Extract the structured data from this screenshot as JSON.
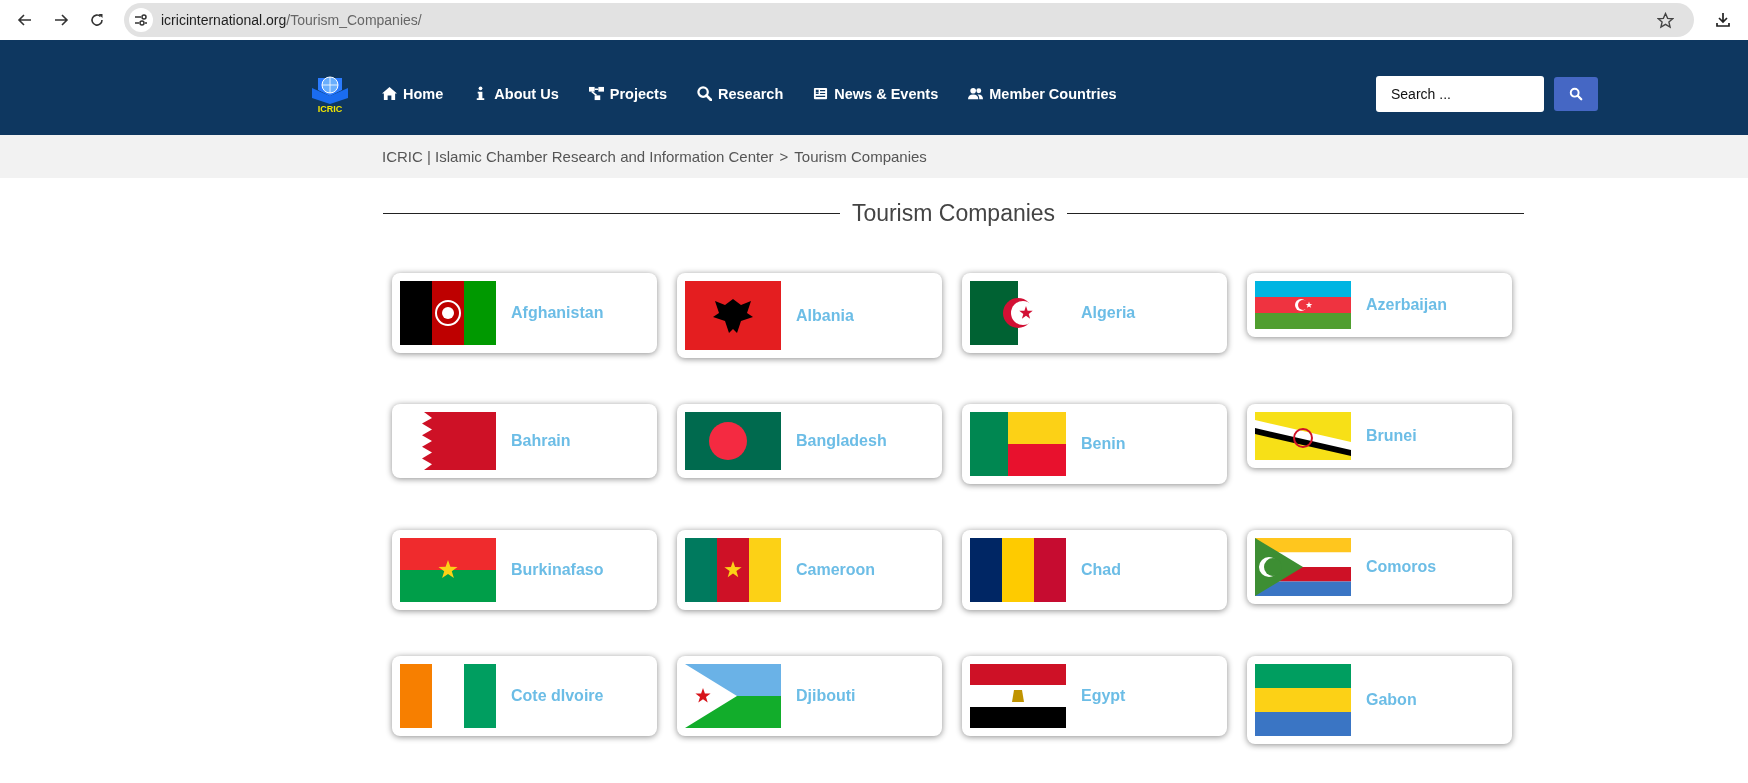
{
  "browser": {
    "url_host": "icricinternational.org",
    "url_path": "/Tourism_Companies/"
  },
  "header": {
    "logo_text": "ICRIC",
    "nav": [
      {
        "label": "Home"
      },
      {
        "label": "About Us"
      },
      {
        "label": "Projects"
      },
      {
        "label": "Research"
      },
      {
        "label": "News & Events"
      },
      {
        "label": "Member Countries"
      }
    ],
    "search": {
      "placeholder": "Search ..."
    }
  },
  "breadcrumb": {
    "site": "ICRIC | Islamic Chamber Research and Information Center",
    "separator": ">",
    "current": "Tourism Companies"
  },
  "heading": "Tourism Companies",
  "countries": [
    {
      "name": "Afghanistan"
    },
    {
      "name": "Albania"
    },
    {
      "name": "Algeria"
    },
    {
      "name": "Azerbaijan"
    },
    {
      "name": "Bahrain"
    },
    {
      "name": "Bangladesh"
    },
    {
      "name": "Benin"
    },
    {
      "name": "Brunei"
    },
    {
      "name": "Burkinafaso"
    },
    {
      "name": "Cameroon"
    },
    {
      "name": "Chad"
    },
    {
      "name": "Comoros"
    },
    {
      "name": "Cote dIvoire"
    },
    {
      "name": "Djibouti"
    },
    {
      "name": "Egypt"
    },
    {
      "name": "Gabon"
    }
  ]
}
